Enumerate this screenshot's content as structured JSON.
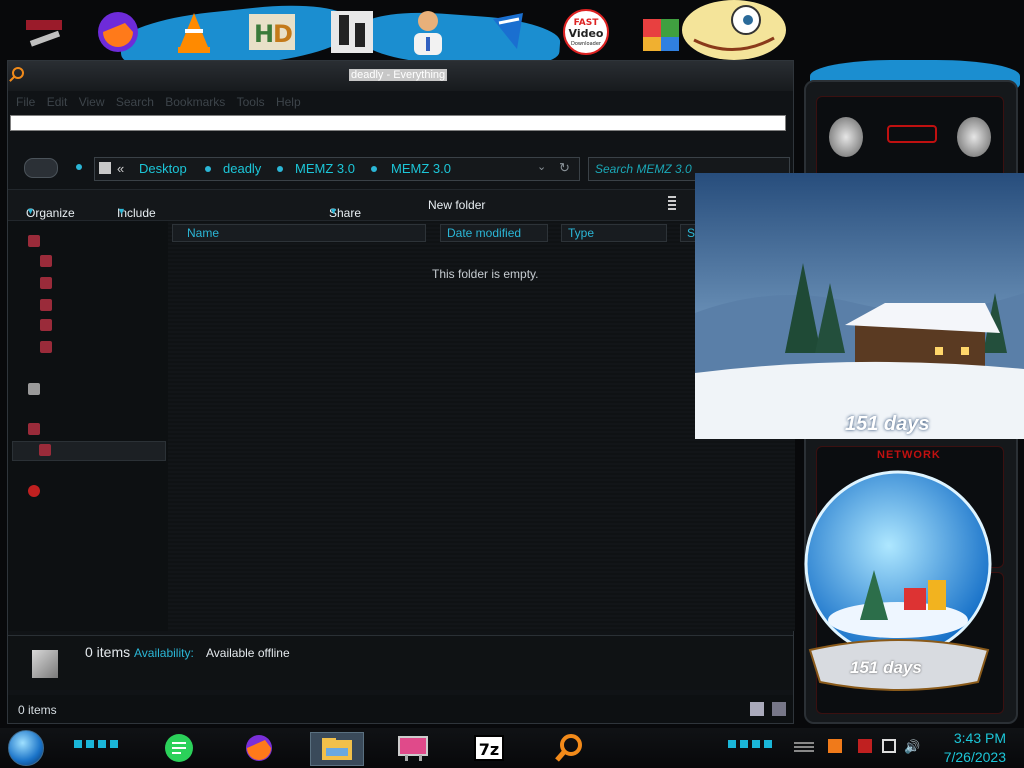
{
  "window": {
    "title": "deadly - Everything",
    "menu": [
      "File",
      "Edit",
      "View",
      "Search",
      "Bookmarks",
      "Tools",
      "Help"
    ]
  },
  "address": {
    "chevrons": "«",
    "crumbs": [
      "Desktop",
      "deadly",
      "MEMZ 3.0",
      "MEMZ 3.0"
    ],
    "search_placeholder": "Search MEMZ 3.0"
  },
  "toolbar": {
    "organize": "Organize",
    "include": "Include selected folder in library",
    "share": "Share with",
    "new_folder": "New folder"
  },
  "columns": [
    "Name",
    "Date modified",
    "Type",
    "Si"
  ],
  "empty_message": "This folder is empty.",
  "details": {
    "count": "0 items",
    "availability_label": "Availability:",
    "availability_value": "Available offline"
  },
  "status": {
    "items": "0 items"
  },
  "gadgets": {
    "countdown": "151 days",
    "globe_countdown": "151 days",
    "network_label": "NETWORK"
  },
  "desktop_icons": [
    "tools-icon",
    "firefox-icon",
    "vlc-icon",
    "hxd-icon",
    "memz-icon",
    "doctor-icon",
    "shield-icon",
    "fast-video-icon",
    "colorful-icon"
  ],
  "fast_video": {
    "line1": "FAST",
    "line2": "Video",
    "line3": "Downloader"
  },
  "taskbar": {
    "time": "3:43 PM",
    "date": "7/26/2023",
    "sevenzip": "7z"
  },
  "colors": {
    "accent": "#1cc6d8",
    "desktop_blue": "#1b8ed0"
  }
}
